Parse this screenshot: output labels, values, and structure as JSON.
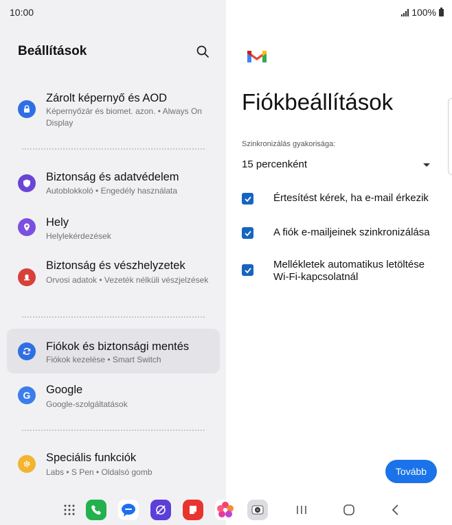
{
  "status": {
    "time": "10:00",
    "battery": "100%"
  },
  "settings": {
    "title": "Beállítások",
    "items": [
      {
        "title": "Zárolt képernyő és AOD",
        "subtitle": "Képernyőzár és biomet. azon.  •  Always On Display",
        "icon": "lock-icon",
        "color": "#2f6fe4"
      },
      {
        "title": "Biztonság és adatvédelem",
        "subtitle": "Autoblokkoló  •  Engedély használata",
        "icon": "shield-icon",
        "color": "#6b45d6"
      },
      {
        "title": "Hely",
        "subtitle": "Helylekérdezések",
        "icon": "location-icon",
        "color": "#7b4fe0"
      },
      {
        "title": "Biztonság és vészhelyzetek",
        "subtitle": "Orvosi adatok  •  Vezeték nélküli vészjelzések",
        "icon": "emergency-icon",
        "color": "#d8403a"
      },
      {
        "title": "Fiókok és biztonsági mentés",
        "subtitle": "Fiókok kezelése  •  Smart Switch",
        "icon": "sync-icon",
        "color": "#2f6fe4"
      },
      {
        "title": "Google",
        "subtitle": "Google-szolgáltatások",
        "icon": "google-icon",
        "color": "#3b7ded"
      },
      {
        "title": "Speciális funkciók",
        "subtitle": "Labs  •  S Pen  •  Oldalsó gomb",
        "icon": "gear-icon",
        "color": "#f2b530"
      }
    ]
  },
  "account": {
    "title": "Fiókbeállítások",
    "sync_label": "Szinkronizálás gyakorisága:",
    "sync_value": "15 percenként",
    "checkboxes": [
      {
        "label": "Értesítést kérek, ha e-mail érkezik",
        "checked": true
      },
      {
        "label": "A fiók e-mailjeinek szinkronizálása",
        "checked": true
      },
      {
        "label": "Mellékletek automatikus letöltése Wi-Fi-kapcsolatnál",
        "checked": true
      }
    ],
    "next_label": "Tovább"
  },
  "dock": {
    "apps": [
      "apps-grid-icon",
      "phone-icon",
      "messages-icon",
      "internet-icon",
      "notes-icon",
      "gallery-icon",
      "camera-icon"
    ],
    "nav": [
      "recents-icon",
      "home-icon",
      "back-icon"
    ]
  },
  "colors": {
    "accent": "#1a73e8",
    "checkbox": "#1565c0",
    "panel_bg": "#f1f1f4",
    "selected_bg": "#e3e3e8"
  }
}
